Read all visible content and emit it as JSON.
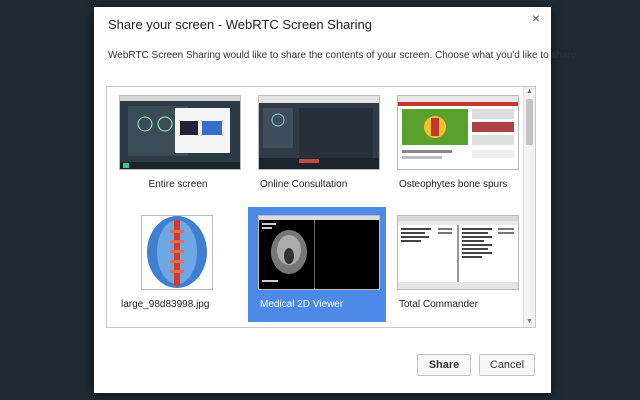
{
  "dialog": {
    "title": "Share your screen - WebRTC Screen Sharing",
    "close_glyph": "×",
    "subtitle": "WebRTC Screen Sharing would like to share the contents of your screen. Choose what you'd like to share."
  },
  "sources": [
    {
      "label": "Entire screen",
      "icon": "desktop-thumbnail"
    },
    {
      "label": "Online Consultation",
      "icon": "window-thumbnail"
    },
    {
      "label": "Osteophytes bone spurs",
      "icon": "browser-thumbnail"
    },
    {
      "label": "large_98d83998.jpg",
      "icon": "spine-image-thumbnail"
    },
    {
      "label": "Medical 2D Viewer",
      "icon": "mri-viewer-thumbnail",
      "selected": true
    },
    {
      "label": "Total Commander",
      "icon": "file-manager-thumbnail"
    }
  ],
  "buttons": {
    "share": "Share",
    "cancel": "Cancel"
  },
  "colors": {
    "selection": "#4d8ae8",
    "backdrop": "#1f2a33"
  }
}
